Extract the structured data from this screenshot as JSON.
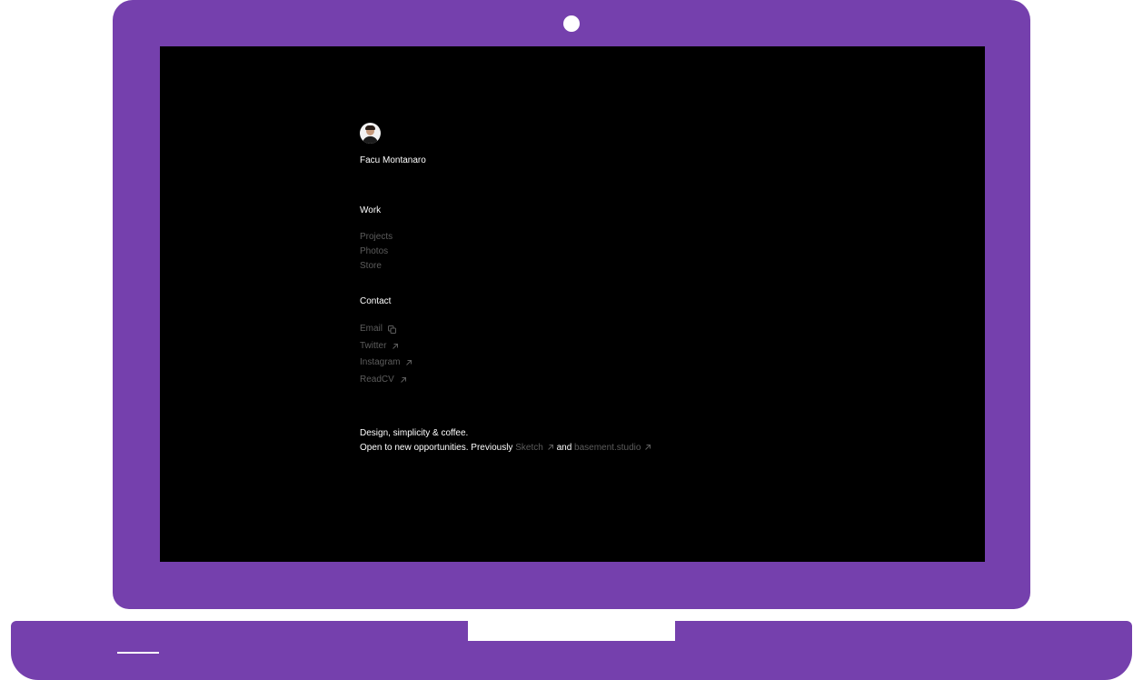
{
  "profile": {
    "name": "Facu Montanaro"
  },
  "work": {
    "title": "Work",
    "items": [
      {
        "label": "Projects"
      },
      {
        "label": "Photos"
      },
      {
        "label": "Store"
      }
    ]
  },
  "contact": {
    "title": "Contact",
    "items": [
      {
        "label": "Email",
        "icon": "copy-icon"
      },
      {
        "label": "Twitter",
        "icon": "arrow-up-right-icon"
      },
      {
        "label": "Instagram",
        "icon": "arrow-up-right-icon"
      },
      {
        "label": "ReadCV",
        "icon": "arrow-up-right-icon"
      }
    ]
  },
  "bio": {
    "line1": "Design, simplicity & coffee.",
    "line2_prefix": "Open to new opportunities. Previously",
    "link1": "Sketch",
    "joiner": "and",
    "link2": "basement.studio"
  },
  "colors": {
    "frame": "#7540ad",
    "screen": "#000000",
    "text_primary": "#ffffff",
    "text_muted": "#5c5c5c"
  }
}
